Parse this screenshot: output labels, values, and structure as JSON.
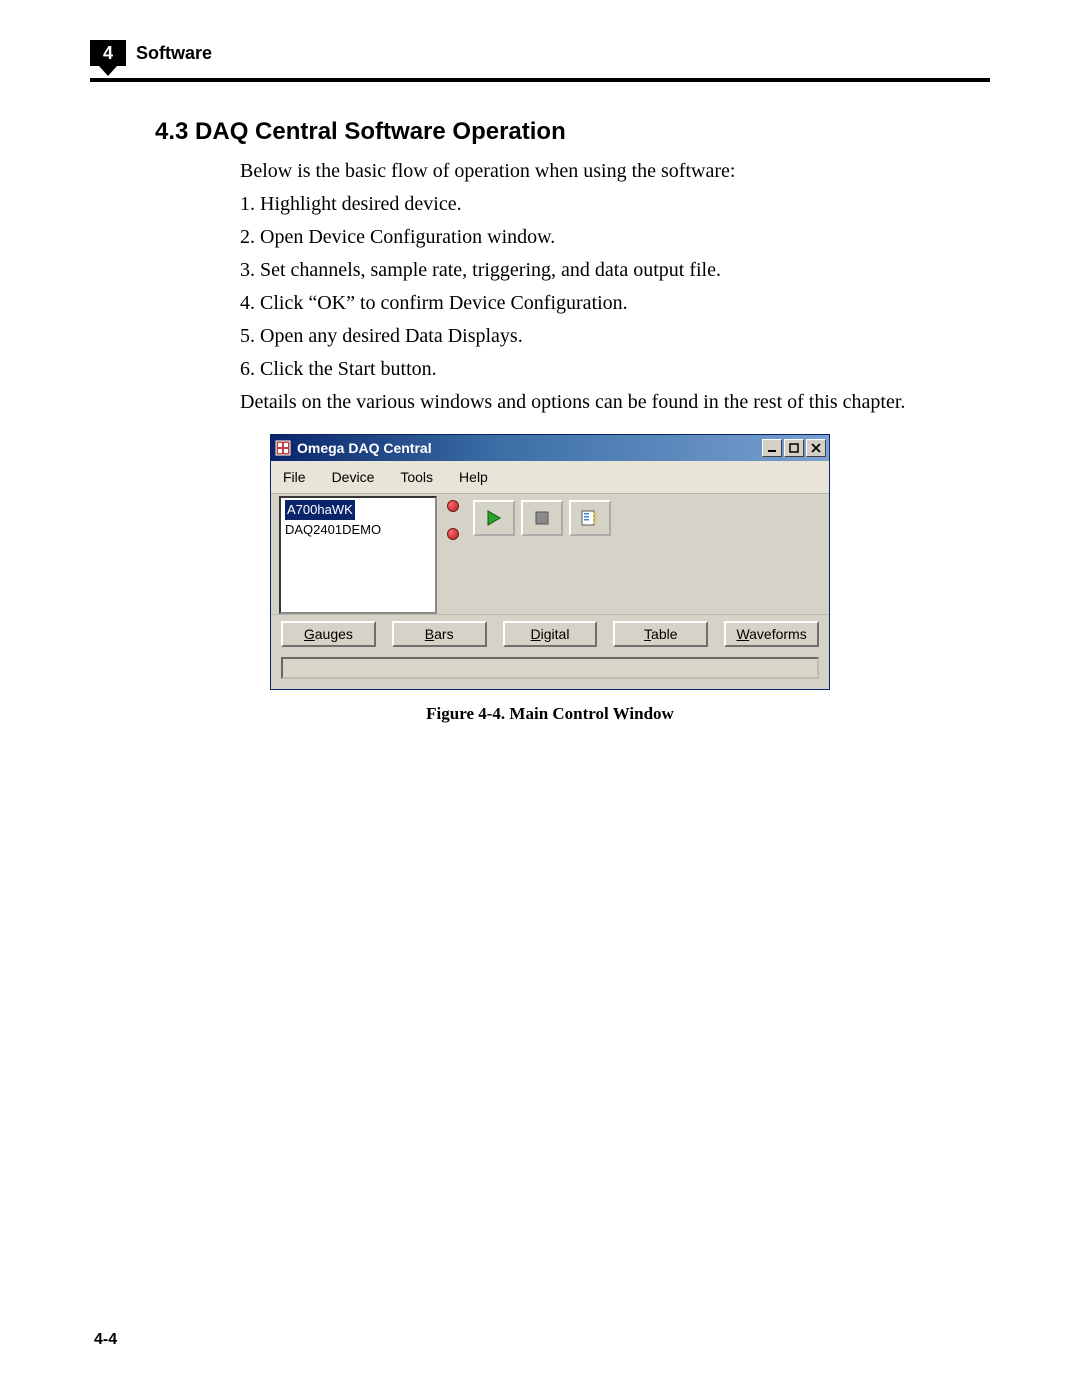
{
  "header": {
    "chapter_number": "4",
    "chapter_label": "Software"
  },
  "section": {
    "heading": "4.3 DAQ Central Software Operation",
    "intro": "Below is the basic flow of operation when using the software:",
    "steps": [
      "1. Highlight desired device.",
      "2. Open Device Configuration window.",
      "3. Set channels, sample rate, triggering, and data output file.",
      "4. Click “OK” to confirm Device Configuration.",
      "5. Open any desired Data Displays.",
      "6. Click the Start button."
    ],
    "outro": "Details on the various windows and options can be found in the rest of this chapter."
  },
  "window": {
    "title": "Omega DAQ Central",
    "menus": {
      "file": "File",
      "device": "Device",
      "tools": "Tools",
      "help": "Help"
    },
    "devices": {
      "selected": "A700haWK",
      "other": "DAQ2401DEMO"
    },
    "display_buttons": {
      "gauges": "Gauges",
      "bars": "Bars",
      "digital": "Digital",
      "table": "Table",
      "waveforms": "Waveforms"
    }
  },
  "figure_caption": "Figure 4-4.  Main Control Window",
  "page_number": "4-4"
}
